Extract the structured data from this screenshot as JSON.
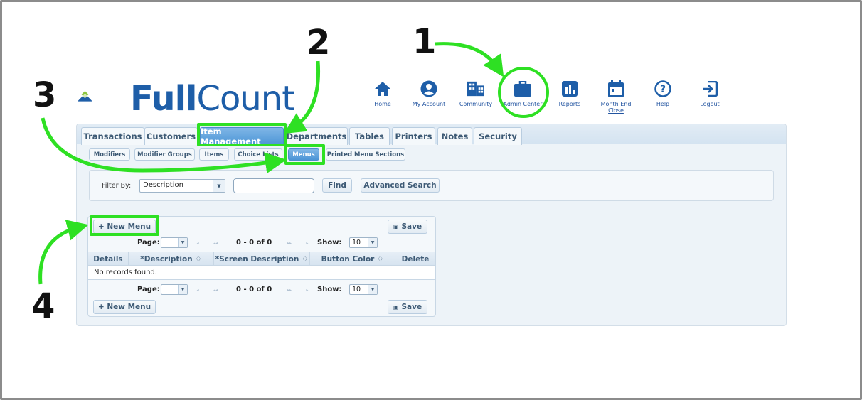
{
  "logo": {
    "part1": "Full",
    "part2": "Count"
  },
  "topnav": [
    {
      "label": "Home",
      "icon": "home-icon"
    },
    {
      "label": "My Account",
      "icon": "user-circle-icon"
    },
    {
      "label": "Community",
      "icon": "building-icon"
    },
    {
      "label": "Admin Center",
      "icon": "briefcase-icon"
    },
    {
      "label": "Reports",
      "icon": "bar-chart-icon"
    },
    {
      "label": "Month End Close",
      "icon": "calendar-icon"
    },
    {
      "label": "Help",
      "icon": "help-circle-icon"
    },
    {
      "label": "Logout",
      "icon": "logout-icon"
    }
  ],
  "tabs": [
    "Transactions",
    "Customers",
    "Item Management",
    "Departments",
    "Tables",
    "Printers",
    "Notes",
    "Security"
  ],
  "active_tab": "Item Management",
  "subtabs": [
    "Modifiers",
    "Modifier Groups",
    "Items",
    "Choice Lists",
    "Menus",
    "Printed Menu Sections"
  ],
  "active_subtab": "Menus",
  "filter": {
    "label": "Filter By:",
    "selected": "Description",
    "input_value": "",
    "find_label": "Find",
    "advanced_label": "Advanced Search"
  },
  "grid": {
    "new_label": "+ New Menu",
    "save_label": "Save",
    "page_label": "Page:",
    "range_text": "0 - 0 of 0",
    "show_label": "Show:",
    "show_value": "10",
    "columns": [
      "Details",
      "*Description ♢",
      "*Screen Description ♢",
      "Button Color ♢",
      "Delete"
    ],
    "empty_text": "No records found."
  },
  "annotations": [
    "1",
    "2",
    "3",
    "4"
  ],
  "colors": {
    "highlight": "#2ee023",
    "brand_blue": "#1e5ea8",
    "brand_green": "#8cc63f",
    "active_tab": "#4c95d6"
  }
}
